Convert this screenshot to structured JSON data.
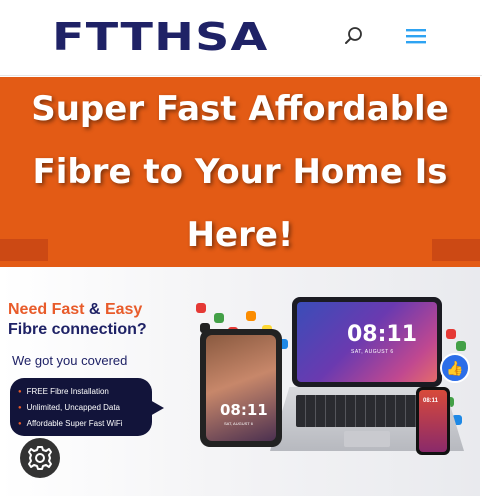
{
  "header": {
    "logo_text": "FTTHSA",
    "icons": {
      "search": "search-icon",
      "menu": "hamburger-menu-icon"
    }
  },
  "hero": {
    "title": "Super Fast Affordable Fibre to Your Home Is Here!"
  },
  "banner": {
    "headline_need": "Need Fast",
    "headline_amp": "&",
    "headline_easy": "Easy",
    "headline_line2": "Fibre connection?",
    "subheadline": "We got you covered",
    "features": [
      "FREE Fibre Installation",
      "Unlimited, Uncapped Data",
      "Affordable Super Fast WiFi"
    ],
    "laptop_time": "08:11",
    "laptop_date": "SAT, AUGUST 6",
    "tablet_time": "08:11",
    "tablet_date": "SAT, AUGUST 6",
    "phone_time": "08:11"
  },
  "cookie": {
    "icon": "gear-icon"
  },
  "colors": {
    "brand_navy": "#1f2266",
    "hero_orange": "#e35b15",
    "accent_orange": "#e85b2a",
    "cookie_button": "#333333"
  }
}
